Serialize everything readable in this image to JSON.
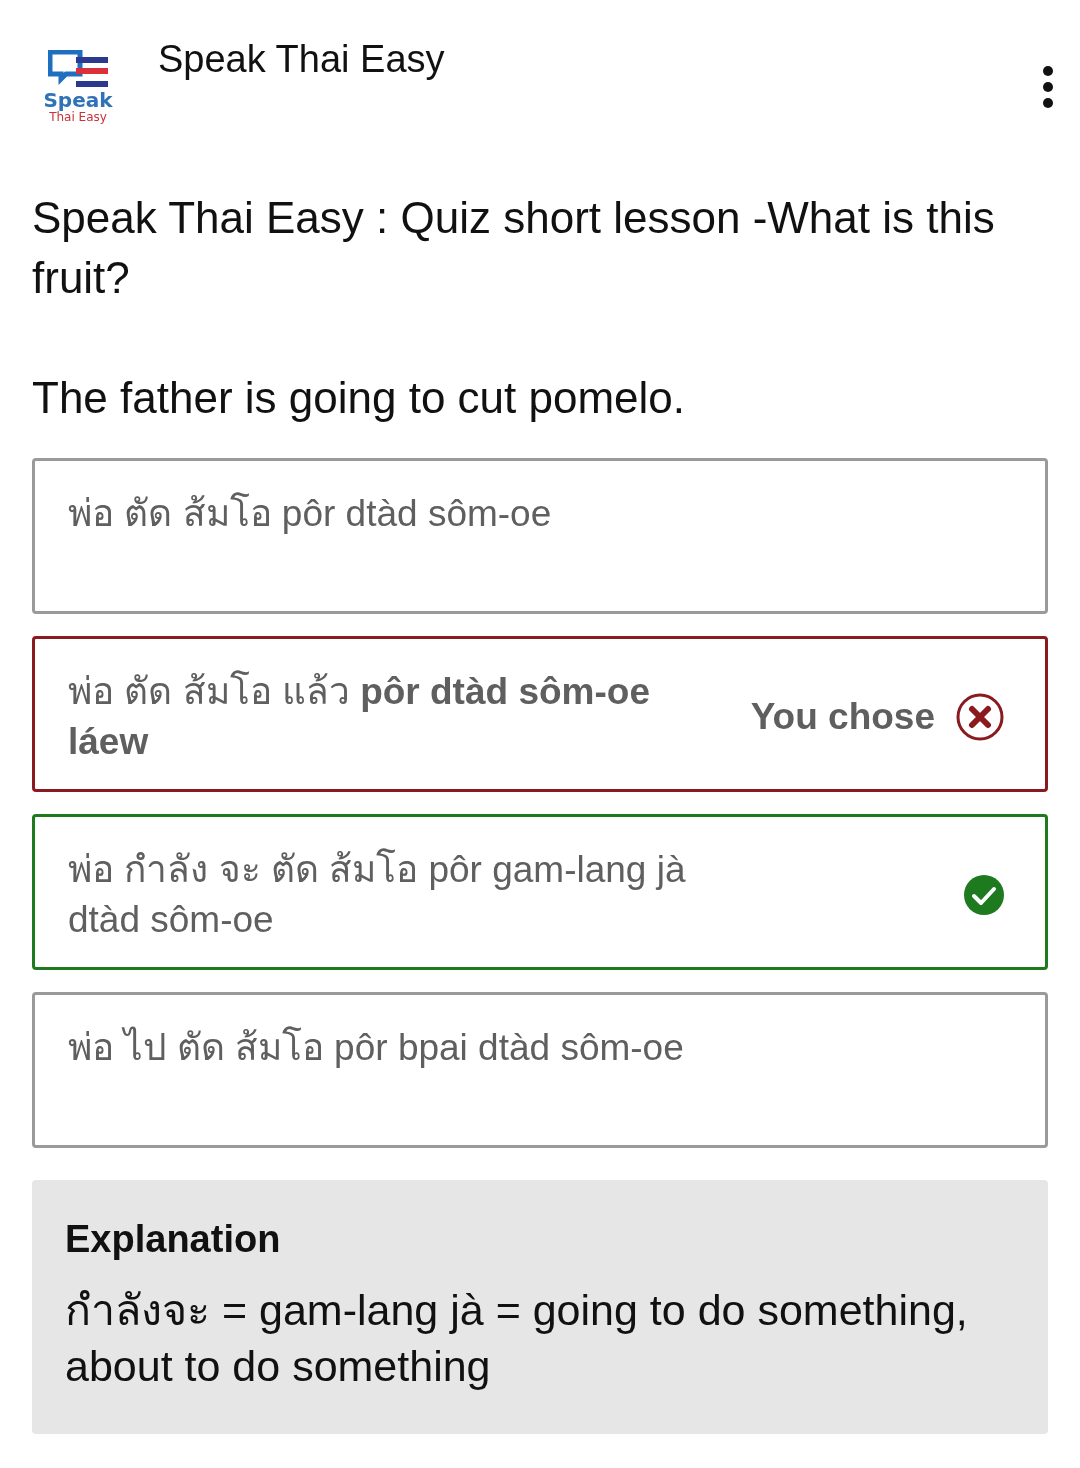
{
  "app_bar": {
    "logo": {
      "line_1": "Speak",
      "line_2": "Thai Easy"
    },
    "title": "Speak Thai Easy"
  },
  "quiz_title": "Speak Thai Easy : Quiz short lesson -What is this fruit?",
  "question": "The father is going to cut pomelo.",
  "options": [
    {
      "text": "พ่อ ตัด ส้มโอ pôr dtàd sôm-oe",
      "kind": "plain"
    },
    {
      "text": "พ่อ ตัด ส้มโอ แล้ว **pôr dtàd sôm-oe láew**",
      "kind": "wrong",
      "chosen_label": "You chose"
    },
    {
      "text": "พ่อ กำลัง จะ ตัด ส้มโอ pôr gam-lang jà dtàd sôm-oe",
      "kind": "correct"
    },
    {
      "text": "พ่อ ไป ตัด ส้มโอ pôr bpai dtàd sôm-oe",
      "kind": "plain"
    }
  ],
  "explanation": {
    "heading": "Explanation",
    "text": "กำลังจะ = gam-lang jà = going to do something, about to do something"
  }
}
